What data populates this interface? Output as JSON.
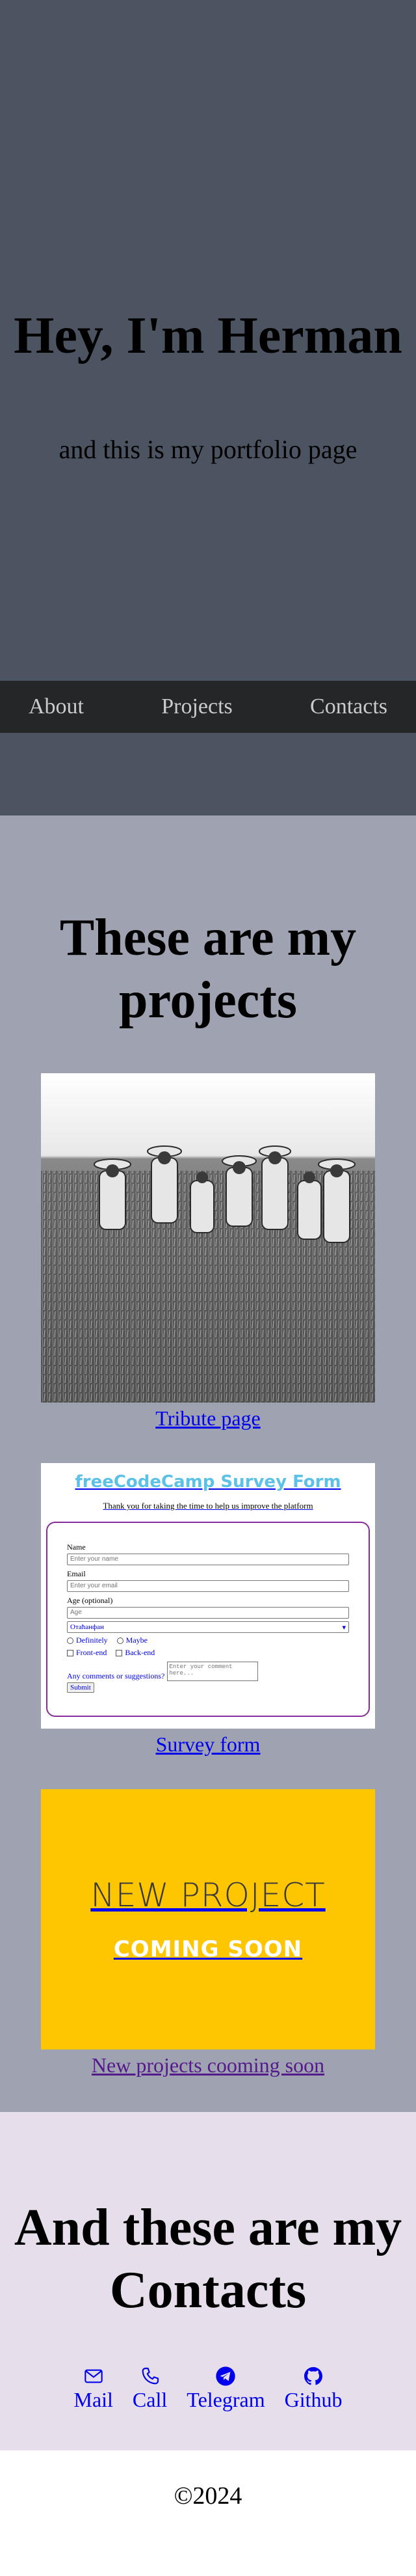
{
  "hero": {
    "title": "Hey, I'm Herman",
    "tagline": "and this is my portfolio page"
  },
  "nav": {
    "items": [
      {
        "label": "About"
      },
      {
        "label": "Projects"
      },
      {
        "label": "Contacts"
      }
    ]
  },
  "projects": {
    "title": "These are my projects",
    "items": [
      {
        "label": "Tribute page"
      },
      {
        "label": "Survey form"
      },
      {
        "label": "New projects cooming soon"
      }
    ],
    "survey_preview": {
      "title": "freeCodeCamp Survey Form",
      "subtitle": "Thank you for taking the time to help us improve the platform",
      "name_label": "Name",
      "name_placeholder": "Enter your name",
      "email_label": "Email",
      "email_placeholder": "Enter your email",
      "age_label": "Age (optional)",
      "age_placeholder": "Age",
      "select_value": "Отаћанфан",
      "radio_1": "Definitely",
      "radio_2": "Maybe",
      "check_1": "Front-end",
      "check_2": "Back-end",
      "comments_label": "Any comments or suggestions?",
      "comments_placeholder": "Enter your comment here...",
      "submit_label": "Submit"
    },
    "new_project_preview": {
      "title": "NEW PROJECT",
      "subtitle": "COMING SOON"
    }
  },
  "contacts": {
    "title": "And these are my Contacts",
    "items": [
      {
        "label": "Mail",
        "icon": "mail-icon"
      },
      {
        "label": "Call",
        "icon": "phone-icon"
      },
      {
        "label": "Telegram",
        "icon": "telegram-icon"
      },
      {
        "label": "Github",
        "icon": "github-icon"
      }
    ]
  },
  "footer": {
    "text": "©2024"
  },
  "colors": {
    "hero_bg": "#4c5361",
    "nav_bg": "#252628",
    "projects_bg": "#9fa2b0",
    "contacts_bg": "#e6dfeb",
    "link": "#0000ee",
    "visited_link": "#551a8b",
    "survey_title": "#5bc1e6",
    "new_project_bg": "#fec501"
  }
}
